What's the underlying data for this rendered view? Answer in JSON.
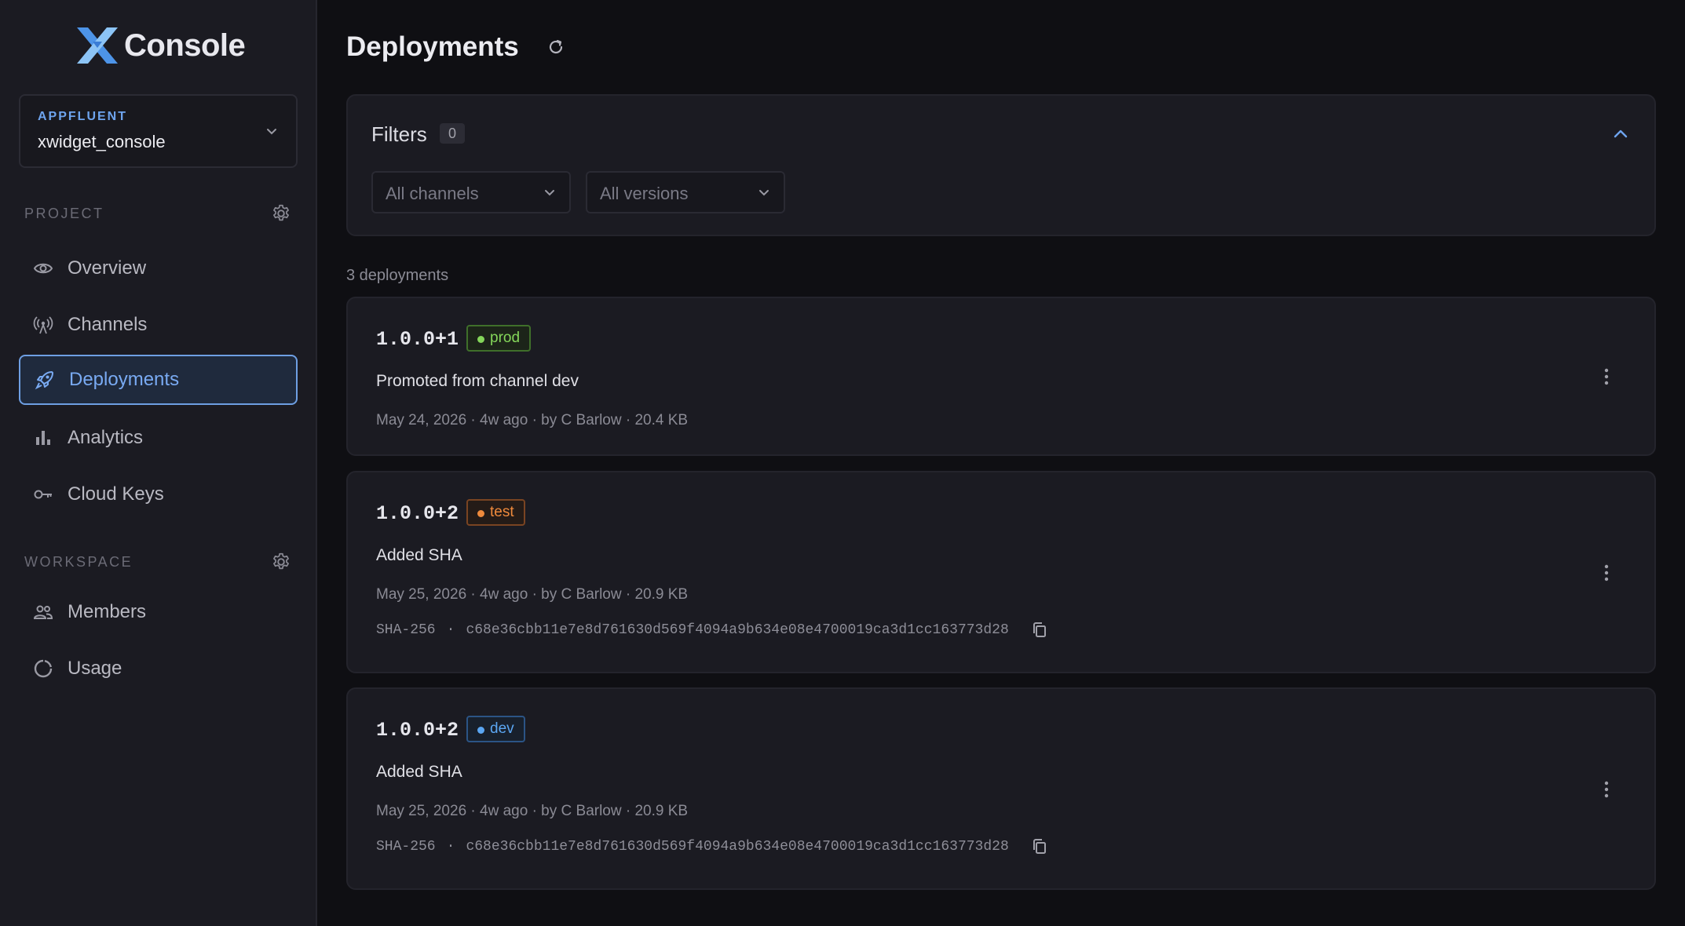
{
  "app": {
    "name": "Console"
  },
  "org_selector": {
    "org": "APPFLUENT",
    "project": "xwidget_console"
  },
  "sidebar": {
    "project_label": "PROJECT",
    "workspace_label": "WORKSPACE",
    "project_items": [
      {
        "label": "Overview",
        "icon": "eye-icon"
      },
      {
        "label": "Channels",
        "icon": "broadcast-icon"
      },
      {
        "label": "Deployments",
        "icon": "rocket-icon",
        "active": true
      },
      {
        "label": "Analytics",
        "icon": "bar-chart-icon"
      },
      {
        "label": "Cloud Keys",
        "icon": "key-icon"
      }
    ],
    "workspace_items": [
      {
        "label": "Members",
        "icon": "members-icon"
      },
      {
        "label": "Usage",
        "icon": "usage-icon"
      }
    ]
  },
  "page": {
    "title": "Deployments"
  },
  "filters": {
    "title": "Filters",
    "count": "0",
    "channels_placeholder": "All channels",
    "versions_placeholder": "All versions"
  },
  "deployments_count": "3 deployments",
  "deployments": [
    {
      "version": "1.0.0+1",
      "channel": "prod",
      "description": "Promoted from channel dev",
      "meta": "May 24, 2026 · 4w ago · by C Barlow · 20.4 KB"
    },
    {
      "version": "1.0.0+2",
      "channel": "test",
      "description": "Added SHA",
      "meta": "May 25, 2026 · 4w ago · by C Barlow · 20.9 KB",
      "sha_label": "SHA-256",
      "sha_sep": "·",
      "sha": "c68e36cbb11e7e8d761630d569f4094a9b634e08e4700019ca3d1cc163773d28"
    },
    {
      "version": "1.0.0+2",
      "channel": "dev",
      "description": "Added SHA",
      "meta": "May 25, 2026 · 4w ago · by C Barlow · 20.9 KB",
      "sha_label": "SHA-256",
      "sha_sep": "·",
      "sha": "c68e36cbb11e7e8d761630d569f4094a9b634e08e4700019ca3d1cc163773d28"
    }
  ],
  "colors": {
    "accent": "#6ea4ee",
    "prod": "#84d65a",
    "test": "#ef8a3c",
    "dev": "#5ba6f2"
  }
}
